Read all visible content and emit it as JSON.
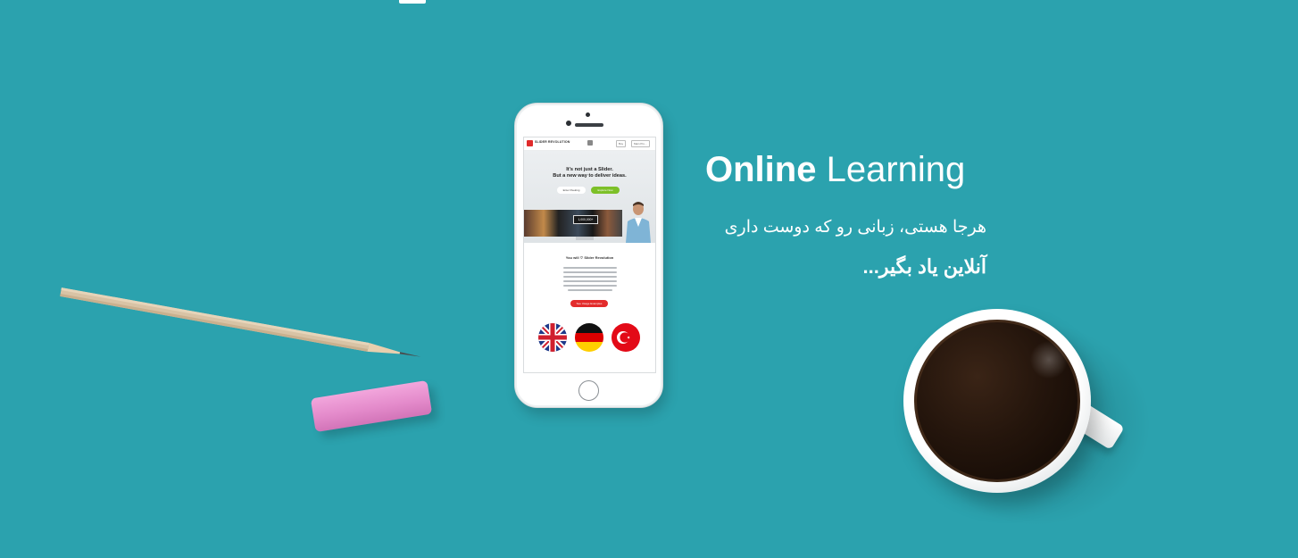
{
  "background_color": "#2ba2ae",
  "headline": {
    "bold": "Online",
    "regular": "Learning"
  },
  "persian": {
    "line1": "هرجا هستی، زبانی رو که دوست داری",
    "line2": "آنلاین یاد بگیر..."
  },
  "phone_screen": {
    "logo_text": "SLIDER REVOLUTION",
    "nav_buttons": [
      "Buy",
      "Main Pro..."
    ],
    "hero_title_line1": "It's not just a Slider.",
    "hero_title_line2": "But a new way to deliver ideas.",
    "hero_button_white": "Enter Peeking",
    "hero_button_green": "Explore Now",
    "badge": "1,000,000+",
    "you_will": "You will ♡ Slider Revolution",
    "red_button": "See Usage Examples",
    "flags": [
      "uk-flag",
      "germany-flag",
      "turkey-flag"
    ]
  }
}
